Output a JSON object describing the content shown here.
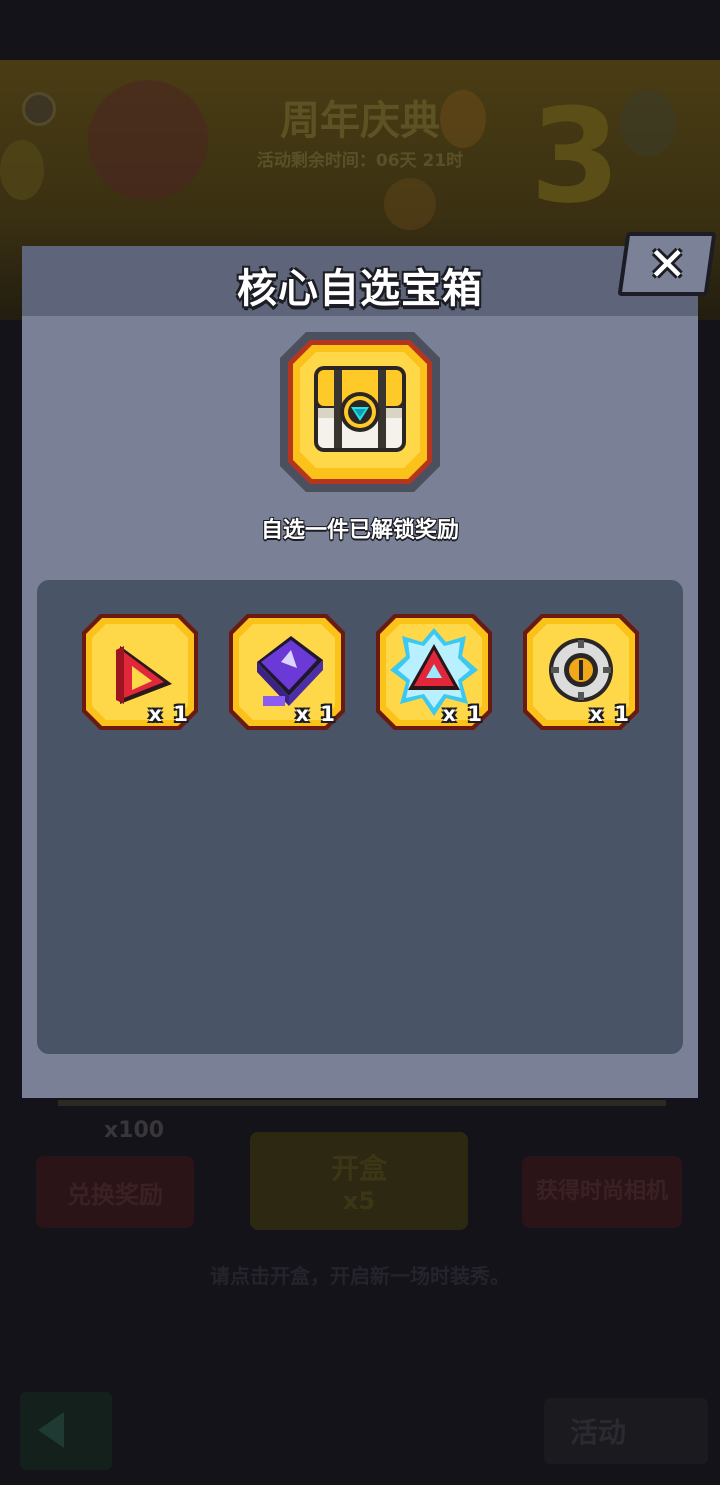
{
  "background": {
    "event_title": "周年庆典",
    "event_timer": "活动剩余时间：06天 21时",
    "badge_number": "3",
    "coin_count": "x100",
    "redeem_button": "兑换奖励",
    "open_button": "开盒",
    "open_cost": "x5",
    "camera_button": "获得时尚相机",
    "hint": "请点击开盒，开启新一场时装秀。",
    "activity_button": "活动"
  },
  "modal": {
    "title": "核心自选宝箱",
    "close_label": "✕",
    "chest_icon": "core-chest-icon",
    "subtitle": "自选一件已解锁奖励",
    "rewards": [
      {
        "icon": "red-triangle-core-icon",
        "quantity": "x 1"
      },
      {
        "icon": "purple-chip-core-icon",
        "quantity": "x 1"
      },
      {
        "icon": "electric-red-crystal-core-icon",
        "quantity": "x 1"
      },
      {
        "icon": "silver-ring-core-icon",
        "quantity": "x 1"
      }
    ]
  },
  "colors": {
    "modal_body": "#7a8196",
    "modal_header": "#5e6479",
    "reward_panel": "#4a5467",
    "item_gold": "#fbc21a",
    "item_border": "#b5351e"
  }
}
